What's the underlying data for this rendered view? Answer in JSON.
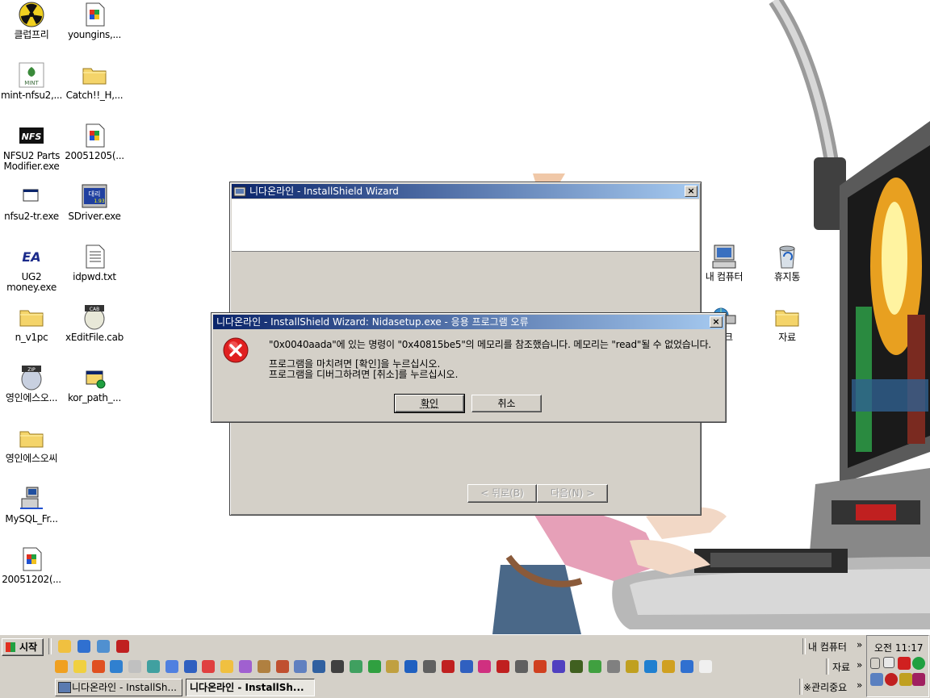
{
  "desktop": {
    "icons": [
      {
        "label": "클럽프리",
        "icon": "radiation-icon"
      },
      {
        "label": "youngins,...",
        "icon": "installer-icon"
      },
      {
        "label": "mint-nfsu2,...",
        "icon": "mint-icon"
      },
      {
        "label": "Catch!!_H,...",
        "icon": "folder-icon"
      },
      {
        "label": "NFSU2 Parts Modifier.exe",
        "icon": "nfs-icon"
      },
      {
        "label": "20051205(...",
        "icon": "installer-icon"
      },
      {
        "label": "nfsu2-tr.exe",
        "icon": "window-icon"
      },
      {
        "label": "SDriver.exe",
        "icon": "sdriver-icon"
      },
      {
        "label": "UG2 money.exe",
        "icon": "ea-icon"
      },
      {
        "label": "idpwd.txt",
        "icon": "text-file-icon"
      },
      {
        "label": "n_v1pc",
        "icon": "folder-icon"
      },
      {
        "label": "xEditFile.cab",
        "icon": "cab-icon"
      },
      {
        "label": "영인에스오...",
        "icon": "zip-icon"
      },
      {
        "label": "kor_path_...",
        "icon": "shortcut-icon"
      },
      {
        "label": "영인에스오씨",
        "icon": "folder-icon"
      },
      {
        "label": "MySQL_Fr...",
        "icon": "network-setup-icon"
      },
      {
        "label": "20051202(...",
        "icon": "installer-icon"
      },
      {
        "label": "내 컴퓨터",
        "icon": "my-computer-icon"
      },
      {
        "label": "휴지통",
        "icon": "recycle-bin-icon"
      },
      {
        "label": "워크",
        "icon": "network-icon"
      },
      {
        "label": "자료",
        "icon": "folder-icon"
      }
    ]
  },
  "installer_window": {
    "title": "니다온라인 - InstallShield Wizard",
    "close_label": "×",
    "back_button": "< 뒤로(B)",
    "next_button": "다음(N) >"
  },
  "error_dialog": {
    "title": "니다온라인 - InstallShield Wizard: Nidasetup.exe - 응용 프로그램 오류",
    "close_label": "×",
    "message_line1": "\"0x0040aada\"에 있는 명령이 \"0x40815be5\"의 메모리를 참조했습니다. 메모리는 \"read\"될 수 없었습니다.",
    "message_line2": "프로그램을 마치려면 [확인]을 누르십시오.",
    "message_line3": "프로그램을 디버그하려면 [취소]를 누르십시오.",
    "ok_button": "확인",
    "cancel_button": "취소"
  },
  "taskbar": {
    "start_label": "시작",
    "tasks": [
      {
        "label": "니다온라인 - InstallSh..."
      },
      {
        "label": "니다온라인 - InstallSh..."
      }
    ],
    "toolbars": [
      "내 컴퓨터",
      "자료",
      "※관리중요"
    ],
    "chevron": "»",
    "clock": "오전 11:17"
  },
  "colors": {
    "titlebar_start": "#0a246a",
    "titlebar_end": "#a6caf0",
    "chrome": "#d4d0c8",
    "error_red": "#e02020"
  }
}
